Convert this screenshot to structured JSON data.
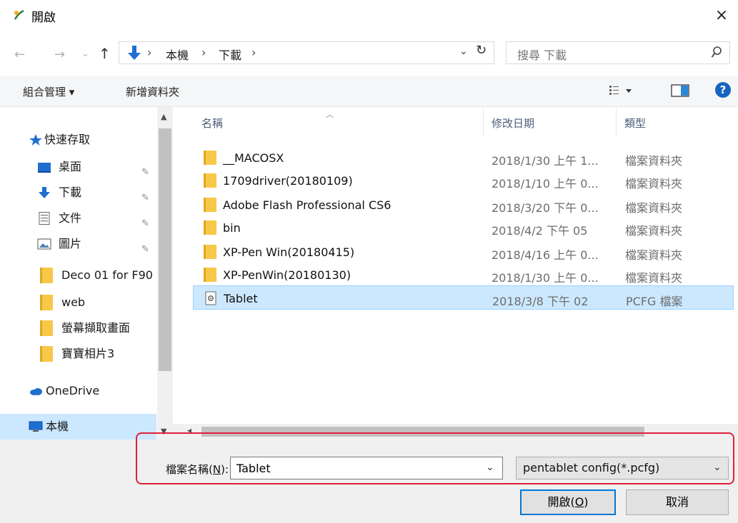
{
  "window": {
    "title": "開啟",
    "close_glyph": "×"
  },
  "nav": {
    "back_glyph": "←",
    "forward_glyph": "→",
    "history_glyph": "⌄",
    "up_glyph": "↑",
    "breadcrumbs": [
      "本機",
      "下載"
    ],
    "separator": "›",
    "dropdown_glyph": "⌄",
    "refresh_glyph": "↻",
    "search_placeholder": "搜尋 下載"
  },
  "command_bar": {
    "organize": "組合管理 ▾",
    "new_folder": "新增資料夾"
  },
  "sidebar": {
    "items": [
      {
        "label": "快速存取",
        "icon": "star-icon"
      },
      {
        "label": "桌面",
        "icon": "desktop-icon",
        "pinned": true
      },
      {
        "label": "下載",
        "icon": "download-icon",
        "pinned": true
      },
      {
        "label": "文件",
        "icon": "document-icon",
        "pinned": true
      },
      {
        "label": "圖片",
        "icon": "picture-icon",
        "pinned": true
      },
      {
        "label": "Deco 01 for F90",
        "icon": "folder-icon"
      },
      {
        "label": "web",
        "icon": "folder-icon"
      },
      {
        "label": "螢幕擷取畫面",
        "icon": "folder-icon"
      },
      {
        "label": "寶寶相片3",
        "icon": "folder-icon"
      },
      {
        "label": "OneDrive",
        "icon": "onedrive-icon"
      },
      {
        "label": "本機",
        "icon": "computer-icon",
        "selected": true
      }
    ],
    "pin_glyph": "📌"
  },
  "file_list": {
    "columns": {
      "name": "名稱",
      "date": "修改日期",
      "type": "類型"
    },
    "rows": [
      {
        "name": "__MACOSX",
        "date": "2018/1/30 上午 1...",
        "type": "檔案資料夾",
        "icon": "folder-icon"
      },
      {
        "name": "1709driver(20180109)",
        "date": "2018/1/10 上午 0...",
        "type": "檔案資料夾",
        "icon": "folder-icon"
      },
      {
        "name": "Adobe Flash Professional CS6",
        "date": "2018/3/20 下午 0...",
        "type": "檔案資料夾",
        "icon": "folder-icon"
      },
      {
        "name": "bin",
        "date": "2018/4/2 下午 05",
        "type": "檔案資料夾",
        "icon": "folder-icon"
      },
      {
        "name": "XP-Pen Win(20180415)",
        "date": "2018/4/16 上午 0...",
        "type": "檔案資料夾",
        "icon": "folder-icon"
      },
      {
        "name": "XP-PenWin(20180130)",
        "date": "2018/1/30 上午 0...",
        "type": "檔案資料夾",
        "icon": "folder-icon"
      },
      {
        "name": "Tablet",
        "date": "2018/3/8 下午 02",
        "type": "PCFG 檔案",
        "icon": "config-file-icon",
        "selected": true
      }
    ]
  },
  "footer": {
    "filename_label": "檔案名稱(N):",
    "filename_label_main": "檔案名稱(",
    "filename_label_key": "N",
    "filename_label_tail": "):",
    "filename_value": "Tablet",
    "filter_value": "pentablet config(*.pcfg)",
    "open_main": "開啟(",
    "open_key": "O",
    "open_tail": ")",
    "cancel": "取消"
  },
  "colors": {
    "selection": "#cce8ff",
    "highlight_border": "#e0203a",
    "accent": "#0078d7"
  }
}
